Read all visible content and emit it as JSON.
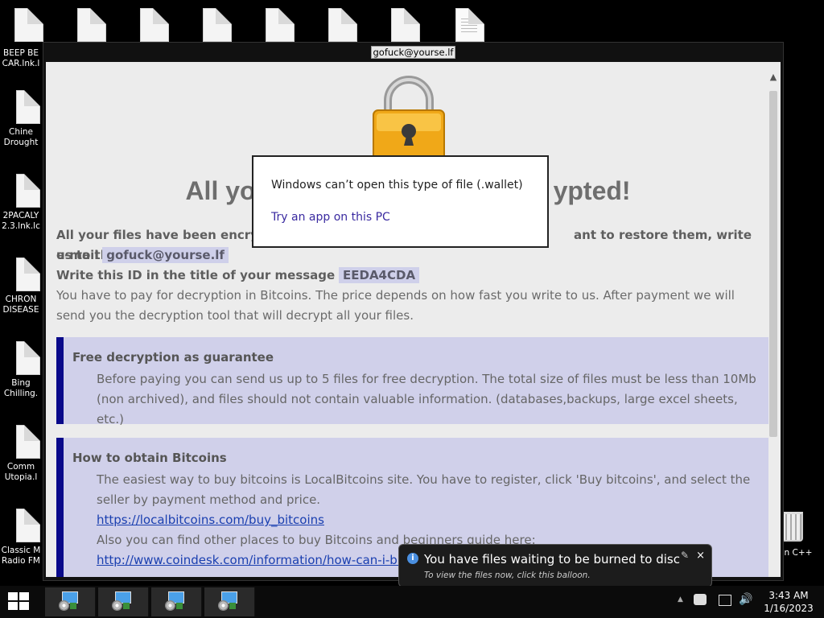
{
  "desktop": {
    "top_icons": [
      "",
      "",
      "",
      "",
      "",
      "",
      "",
      ""
    ],
    "left_icons": [
      {
        "label1": "BEEP BE",
        "label2": "CAR.lnk.l"
      },
      {
        "label1": "Chine",
        "label2": "Drought"
      },
      {
        "label1": "2PACALY",
        "label2": "2.3.lnk.lc"
      },
      {
        "label1": "CHRON",
        "label2": "DISEASE"
      },
      {
        "label1": "Bing",
        "label2": "Chilling."
      },
      {
        "label1": "Comm",
        "label2": "Utopia.l"
      },
      {
        "label1": "Classic M",
        "label2": "Radio FM"
      }
    ],
    "right_icon_label": "n C++"
  },
  "ransom": {
    "window_title": "gofuck@yourse.lf",
    "headline_left": "All yo",
    "headline_right": "ypted!",
    "line1_left": "All your files have been encrypte",
    "line1_right": "ant to restore them, write us to the",
    "email_label": "e-mail",
    "email": "gofuck@yourse.lf",
    "id_label": "Write this ID in the title of your message",
    "id_value": "EEDA4CDA",
    "pay_text": "You have to pay for decryption in Bitcoins. The price depends on how fast you write to us. After payment we will send you the decryption tool that will decrypt all your files.",
    "box1_title": "Free decryption as guarantee",
    "box1_text": "Before paying you can send us up to 5 files for free decryption. The total size of files must be less than 10Mb (non archived), and files should not contain valuable information. (databases,backups, large excel sheets, etc.)",
    "box2_title": "How to obtain Bitcoins",
    "box2_text": "The easiest way to buy bitcoins is LocalBitcoins site. You have to register, click 'Buy bitcoins', and select the seller by payment method and price.",
    "box2_link1": "https://localbitcoins.com/buy_bitcoins",
    "box2_text2": "Also you can find other places to buy Bitcoins and beginners guide here:",
    "box2_link2": "http://www.coindesk.com/information/how-can-i-buy-bitcoi"
  },
  "dialog": {
    "message": "Windows can’t open this type of file (.wallet)",
    "link": "Try an app on this PC"
  },
  "balloon": {
    "title": "You have files waiting to be burned to disc",
    "subtitle": "To view the files now, click this balloon.",
    "close": "×",
    "icon_letter": "i"
  },
  "taskbar": {
    "time": "3:43 AM",
    "date": "1/16/2023"
  }
}
